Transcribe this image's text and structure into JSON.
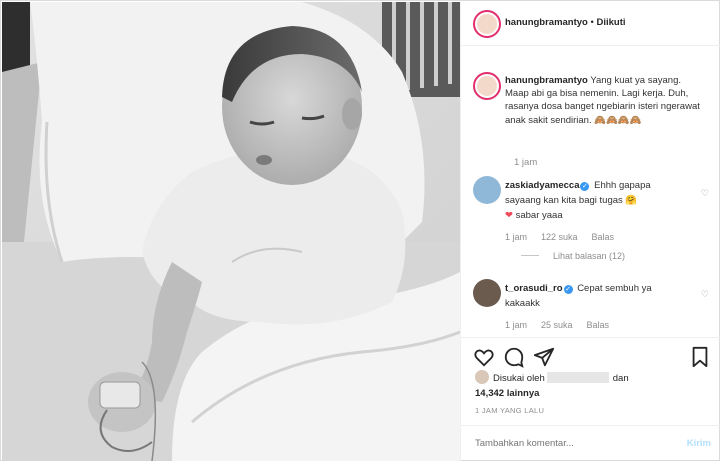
{
  "post": {
    "author": "hanungbramantyo",
    "separator": "•",
    "follow_status": "Diikuti",
    "caption": "Yang kuat ya sayang. Maap abi ga bisa nemenin. Lagi kerja. Duh, rasanya dosa banget ngebiarin isteri ngerawat anak sakit sendirian. 🙈🙈🙈🙈",
    "caption_time": "1 jam",
    "photo_icon": "hospital-child-photo"
  },
  "comments": [
    {
      "username": "zaskiadyamecca",
      "verified": true,
      "text_1": "Ehhh gapapa sayaang kan kita bagi tugas 🤗",
      "text_2": "sabar yaaa",
      "heart_icon": "heart-icon",
      "time": "1 jam",
      "likes": "122 suka",
      "reply": "Balas",
      "view_replies": "Lihat balasan (12)"
    },
    {
      "username": "t_orasudi_ro",
      "verified": true,
      "text": "Cepat sembuh ya kakaakk",
      "time": "1 jam",
      "likes": "25 suka",
      "reply": "Balas"
    }
  ],
  "actions": {
    "like_icon": "heart-outline-icon",
    "comment_icon": "comment-icon",
    "share_icon": "share-icon",
    "save_icon": "bookmark-icon"
  },
  "likes": {
    "prefix": "Disukai oleh",
    "connector": "dan",
    "count": "14,342 lainnya"
  },
  "timestamp": "1 JAM YANG LALU",
  "add_comment": {
    "placeholder": "Tambahkan komentar...",
    "submit": "Kirim"
  },
  "colors": {
    "verified": "#3897f0",
    "submit_disabled": "#b2dffc",
    "heart": "#ed4956"
  }
}
